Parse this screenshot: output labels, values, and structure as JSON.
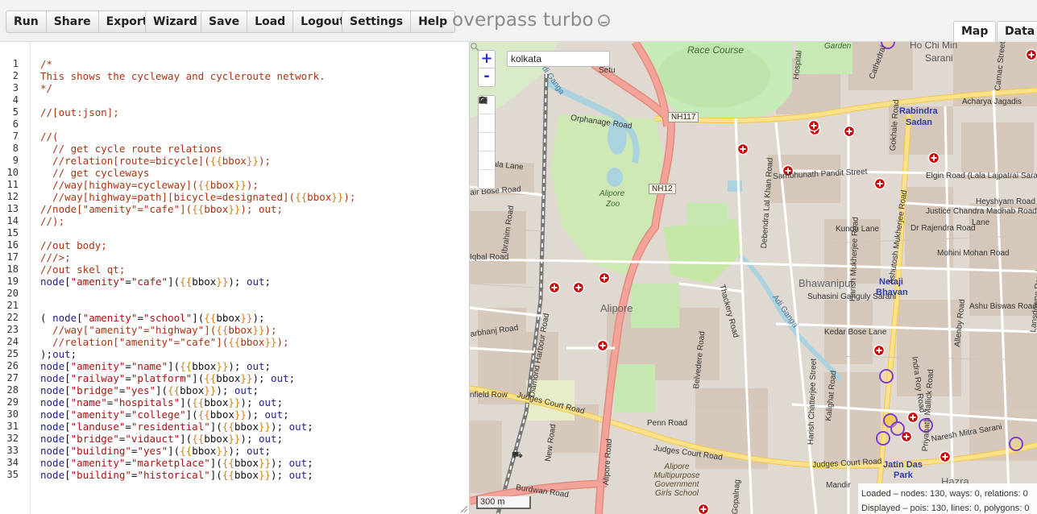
{
  "toolbar": {
    "group1": [
      "Run",
      "Share",
      "Export"
    ],
    "wizard": "Wizard",
    "group2": [
      "Save",
      "Load",
      "Logout"
    ],
    "group3": [
      "Settings",
      "Help"
    ],
    "brand": "overpass turbo",
    "tabs": [
      "Map",
      "Data"
    ]
  },
  "editor": {
    "line_numbers": [
      "1",
      "2",
      "3",
      "4",
      "5",
      "6",
      "7",
      "8",
      "9",
      "10",
      "11",
      "12",
      "13",
      "14",
      "15",
      "16",
      "17",
      "18",
      "19",
      "20",
      "21",
      "22",
      "23",
      "24",
      "25",
      "26",
      "27",
      "28",
      "29",
      "30",
      "31",
      "32",
      "33",
      "34",
      "35"
    ],
    "lines": [
      [
        [
          "c",
          "/*"
        ]
      ],
      [
        [
          "c",
          "This shows the cycleway and cycleroute network."
        ]
      ],
      [
        [
          "c",
          "*/"
        ]
      ],
      [],
      [
        [
          "c",
          "//[out:json];"
        ]
      ],
      [],
      [
        [
          "c",
          "//("
        ]
      ],
      [
        [
          "c",
          "  // get cycle route relations"
        ]
      ],
      [
        [
          "c",
          "  //relation[route=bicycle]("
        ],
        [
          "t",
          "{{"
        ],
        [
          "c",
          "bbox"
        ],
        [
          "t",
          "}}"
        ],
        [
          "c",
          ");"
        ]
      ],
      [
        [
          "c",
          "  // get cycleways"
        ]
      ],
      [
        [
          "c",
          "  //way[highway=cycleway]("
        ],
        [
          "t",
          "{{"
        ],
        [
          "c",
          "bbox"
        ],
        [
          "t",
          "}}"
        ],
        [
          "c",
          ");"
        ]
      ],
      [
        [
          "c",
          "  //way[highway=path][bicycle=designated]("
        ],
        [
          "t",
          "{{"
        ],
        [
          "c",
          "bbox"
        ],
        [
          "t",
          "}}"
        ],
        [
          "c",
          ");"
        ]
      ],
      [
        [
          "c",
          "//node[\"amenity\"=\"cafe\"]("
        ],
        [
          "t",
          "{{"
        ],
        [
          "c",
          "bbox"
        ],
        [
          "t",
          "}}"
        ],
        [
          "c",
          "); out;"
        ]
      ],
      [
        [
          "c",
          "//);"
        ]
      ],
      [],
      [
        [
          "c",
          "//out body;"
        ]
      ],
      [
        [
          "c",
          "///>;"
        ]
      ],
      [
        [
          "c",
          "//out skel qt;"
        ]
      ],
      [
        [
          "k",
          "node"
        ],
        [
          "p",
          "["
        ],
        [
          "s",
          "\"amenity\""
        ],
        [
          "p",
          "="
        ],
        [
          "s",
          "\"cafe\""
        ],
        [
          "p",
          "]("
        ],
        [
          "t",
          "{{"
        ],
        [
          "p",
          "bbox"
        ],
        [
          "t",
          "}}"
        ],
        [
          "p",
          "); "
        ],
        [
          "k",
          "out"
        ],
        [
          "p",
          ";"
        ]
      ],
      [],
      [],
      [
        [
          "p",
          "( "
        ],
        [
          "k",
          "node"
        ],
        [
          "p",
          "["
        ],
        [
          "s",
          "\"amenity\""
        ],
        [
          "p",
          "="
        ],
        [
          "s",
          "\"school\""
        ],
        [
          "p",
          "]("
        ],
        [
          "t",
          "{{"
        ],
        [
          "p",
          "bbox"
        ],
        [
          "t",
          "}}"
        ],
        [
          "p",
          ");"
        ]
      ],
      [
        [
          "c",
          "  //way[\"amenity\"=\"highway\"]("
        ],
        [
          "t",
          "{{"
        ],
        [
          "c",
          "bbox"
        ],
        [
          "t",
          "}}"
        ],
        [
          "c",
          ");"
        ]
      ],
      [
        [
          "c",
          "  //relation[\"amenity\"=\"cafe\"]("
        ],
        [
          "t",
          "{{"
        ],
        [
          "c",
          "bbox"
        ],
        [
          "t",
          "}}"
        ],
        [
          "c",
          ");"
        ]
      ],
      [
        [
          "p",
          ");"
        ],
        [
          "k",
          "out"
        ],
        [
          "p",
          ";"
        ]
      ],
      [
        [
          "k",
          "node"
        ],
        [
          "p",
          "["
        ],
        [
          "s",
          "\"amenity\""
        ],
        [
          "p",
          "="
        ],
        [
          "s",
          "\"name\""
        ],
        [
          "p",
          "]("
        ],
        [
          "t",
          "{{"
        ],
        [
          "p",
          "bbox"
        ],
        [
          "t",
          "}}"
        ],
        [
          "p",
          "); "
        ],
        [
          "k",
          "out"
        ],
        [
          "p",
          ";"
        ]
      ],
      [
        [
          "k",
          "node"
        ],
        [
          "p",
          "["
        ],
        [
          "s",
          "\"railway\""
        ],
        [
          "p",
          "="
        ],
        [
          "s",
          "\"platform\""
        ],
        [
          "p",
          "]("
        ],
        [
          "t",
          "{{"
        ],
        [
          "p",
          "bbox"
        ],
        [
          "t",
          "}}"
        ],
        [
          "p",
          "); "
        ],
        [
          "k",
          "out"
        ],
        [
          "p",
          ";"
        ]
      ],
      [
        [
          "k",
          "node"
        ],
        [
          "p",
          "["
        ],
        [
          "s",
          "\"bridge\""
        ],
        [
          "p",
          "="
        ],
        [
          "s",
          "\"yes\""
        ],
        [
          "p",
          "]("
        ],
        [
          "t",
          "{{"
        ],
        [
          "p",
          "bbox"
        ],
        [
          "t",
          "}}"
        ],
        [
          "p",
          "); "
        ],
        [
          "k",
          "out"
        ],
        [
          "p",
          ";"
        ]
      ],
      [
        [
          "k",
          "node"
        ],
        [
          "p",
          "["
        ],
        [
          "s",
          "\"name\""
        ],
        [
          "p",
          "="
        ],
        [
          "s",
          "\"hospitals\""
        ],
        [
          "p",
          "]("
        ],
        [
          "t",
          "{{"
        ],
        [
          "p",
          "bbox"
        ],
        [
          "t",
          "}}"
        ],
        [
          "p",
          "); "
        ],
        [
          "k",
          "out"
        ],
        [
          "p",
          ";"
        ]
      ],
      [
        [
          "k",
          "node"
        ],
        [
          "p",
          "["
        ],
        [
          "s",
          "\"amenity\""
        ],
        [
          "p",
          "="
        ],
        [
          "s",
          "\"college\""
        ],
        [
          "p",
          "]("
        ],
        [
          "t",
          "{{"
        ],
        [
          "p",
          "bbox"
        ],
        [
          "t",
          "}}"
        ],
        [
          "p",
          "); "
        ],
        [
          "k",
          "out"
        ],
        [
          "p",
          ";"
        ]
      ],
      [
        [
          "k",
          "node"
        ],
        [
          "p",
          "["
        ],
        [
          "s",
          "\"landuse\""
        ],
        [
          "p",
          "="
        ],
        [
          "s",
          "\"residential\""
        ],
        [
          "p",
          "]("
        ],
        [
          "t",
          "{{"
        ],
        [
          "p",
          "bbox"
        ],
        [
          "t",
          "}}"
        ],
        [
          "p",
          "); "
        ],
        [
          "k",
          "out"
        ],
        [
          "p",
          ";"
        ]
      ],
      [
        [
          "k",
          "node"
        ],
        [
          "p",
          "["
        ],
        [
          "s",
          "\"bridge\""
        ],
        [
          "p",
          "="
        ],
        [
          "s",
          "\"vidauct\""
        ],
        [
          "p",
          "]("
        ],
        [
          "t",
          "{{"
        ],
        [
          "p",
          "bbox"
        ],
        [
          "t",
          "}}"
        ],
        [
          "p",
          "); "
        ],
        [
          "k",
          "out"
        ],
        [
          "p",
          ";"
        ]
      ],
      [
        [
          "k",
          "node"
        ],
        [
          "p",
          "["
        ],
        [
          "s",
          "\"building\""
        ],
        [
          "p",
          "="
        ],
        [
          "s",
          "\"yes\""
        ],
        [
          "p",
          "]("
        ],
        [
          "t",
          "{{"
        ],
        [
          "p",
          "bbox"
        ],
        [
          "t",
          "}}"
        ],
        [
          "p",
          "); "
        ],
        [
          "k",
          "out"
        ],
        [
          "p",
          ";"
        ]
      ],
      [
        [
          "k",
          "node"
        ],
        [
          "p",
          "["
        ],
        [
          "s",
          "\"amenity\""
        ],
        [
          "p",
          "="
        ],
        [
          "s",
          "\"marketplace\""
        ],
        [
          "p",
          "]("
        ],
        [
          "t",
          "{{"
        ],
        [
          "p",
          "bbox"
        ],
        [
          "t",
          "}}"
        ],
        [
          "p",
          "); "
        ],
        [
          "k",
          "out"
        ],
        [
          "p",
          ";"
        ]
      ],
      [
        [
          "k",
          "node"
        ],
        [
          "p",
          "["
        ],
        [
          "s",
          "\"building\""
        ],
        [
          "p",
          "="
        ],
        [
          "s",
          "\"historical\""
        ],
        [
          "p",
          "]("
        ],
        [
          "t",
          "{{"
        ],
        [
          "p",
          "bbox"
        ],
        [
          "t",
          "}}"
        ],
        [
          "p",
          "); "
        ],
        [
          "k",
          "out"
        ],
        [
          "p",
          ";"
        ]
      ]
    ]
  },
  "map": {
    "search_value": "kolkata",
    "zoom_in": "+",
    "zoom_out": "-",
    "scale": "300 m",
    "labels": {
      "race_course": "Race Course",
      "garden": "Garden",
      "ho_chi_min": "Ho Chi Min",
      "sarani": "Sarani",
      "nh117": "NH117",
      "nh12": "NH12",
      "rabindra": "Rabindra",
      "sadan": "Sadan",
      "acharya": "Acharya Jagadis",
      "elgin": "Elgin Road (Lala Lajpatrai Sarani",
      "sambhunath": "Sambhunath Pandit Street",
      "orphanage": "Orphanage Road",
      "alipore_zoo1": "Alipore",
      "alipore_zoo2": "Zoo",
      "alipore": "Alipore",
      "bhawanipur": "Bhawanipur",
      "netaji1": "Netaji",
      "netaji2": "Bhavan",
      "jatin1": "Jatin Das",
      "jatin2": "Park",
      "hazra": "Hazra",
      "judges1": "Judges Court Road",
      "judges2": "Judges Court Road",
      "judges3": "Judges Court Road",
      "burdwan": "Burdwan Road",
      "penn": "Penn Road",
      "alipore_road": "Alipore Road",
      "diamond": "Diamond Harbour Road",
      "belvedere": "Belvedere Road",
      "kundu": "Kundu Lane",
      "justice": "Justice Chandra Madhab Road",
      "heyshyam": "Heyshyam Road",
      "rajendra": "Dr Rajendra Road",
      "mohini": "Mohini Mohan Road",
      "ashu": "Ashu Biswas Road",
      "kedar": "Kedar Bose Lane",
      "suhasini": "Suhasini Ganguly Sarani",
      "naresh": "Naresh Mitra Sarani",
      "school": "Alipore Multipurpose Government Girls School",
      "setu": "Setu",
      "camac": "Camac Street",
      "gokhale": "Gokhale Road",
      "cathedral": "Cathedral",
      "hospital": "Hospital",
      "ashutosh": "Ashutosh Mukherjee Road",
      "harish": "Harish Mukherjee Road",
      "lansdowne": "Lansdowne Road",
      "allenby": "Allenby Road",
      "debendra": "Debendra Lal Khan Road",
      "thackery": "Thackery Road",
      "adiganga": "Adi Ganga",
      "ganga": "di Ganga",
      "iqbal": "Iqbal Road",
      "ibrahim": "Ibrahim Road",
      "arbhanj": "arbhanj Road",
      "airbose": "air Bose Road",
      "sala": "sala Lane",
      "infield": "nfield Row",
      "newroad": "New Road",
      "gopalnagar": "Gopalnag",
      "kalighat": "Kalighat Road",
      "harishchat": "Harish Chatterjee Street",
      "indraroy": "Indra Roy Road",
      "priyanath": "Priyanath Mallick Road",
      "mandir": "Mandir",
      "heyshyam2": "Lane"
    },
    "stats_loaded": "Loaded – nodes: 130, ways: 0, relations: 0",
    "stats_displayed": "Displayed – pois: 130, lines: 0, polygons: 0",
    "colors": {
      "primary_road": "#f4a39a",
      "secondary_road": "#f7d67a",
      "park": "#c5e8b1",
      "water": "#aad3df",
      "poi_hospital": "#cc0000",
      "poi_school": "#7b3fd6"
    }
  }
}
